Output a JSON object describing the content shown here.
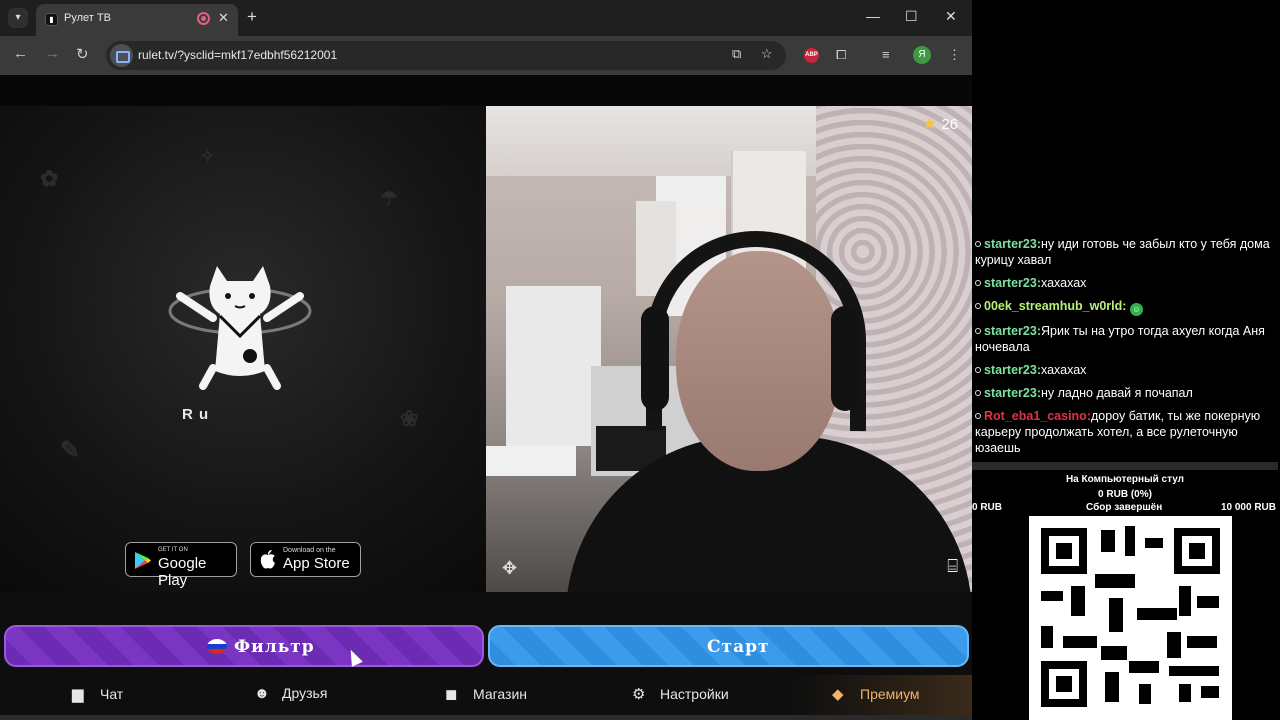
{
  "browser": {
    "tab_title": "Рулет ТВ",
    "url": "rulet.tv/?ysclid=mkf17edbhf56212001",
    "profile_initial": "Я",
    "extension_badge": "ABP",
    "controls": {
      "minimize": "—",
      "maximize": "☐",
      "close": "✕"
    },
    "new_tab": "+",
    "tab_close": "✕"
  },
  "page": {
    "logo_tag": "R u",
    "google_play": {
      "small": "GET IT ON",
      "big": "Google Play"
    },
    "app_store": {
      "small": "Download on the",
      "big": "App Store"
    },
    "star_count": "26",
    "filter_label": "Фильтр",
    "start_label": "Старт",
    "nav": {
      "chat": "Чат",
      "friends": "Друзья",
      "shop": "Магазин",
      "settings": "Настройки",
      "premium": "Премиум"
    },
    "colors": {
      "filter": "#6b2bb3",
      "start": "#2f8ee0",
      "premium": "#f0b46a"
    }
  },
  "chat": {
    "messages": [
      {
        "user": "starter23:",
        "text": "ну иди готовь че забыл кто у тебя дома курицу хавал",
        "color": "#7de0a0"
      },
      {
        "user": "starter23:",
        "text": "хахахах",
        "color": "#7de0a0"
      },
      {
        "user": "00ek_streamhub_w0rld:",
        "text": "",
        "color": "#b8f07a",
        "emoji": true
      },
      {
        "user": "starter23:",
        "text": "Ярик ты на утро тогда ахуел когда Аня ночевала",
        "color": "#7de0a0"
      },
      {
        "user": "starter23:",
        "text": "хахахах",
        "color": "#7de0a0"
      },
      {
        "user": "starter23:",
        "text": "ну ладно давай я почапал",
        "color": "#7de0a0"
      },
      {
        "user": "Rot_eba1_casino:",
        "text": "дороу батик, ты же покерную карьеру продолжать хотел, а все рулеточную юзаешь",
        "color": "#e0304a"
      }
    ]
  },
  "goal": {
    "title": "На Компьютерный стул",
    "amount": "0 RUB (0%)",
    "min": "0 RUB",
    "status": "Сбор завершён",
    "max": "10 000 RUB"
  }
}
